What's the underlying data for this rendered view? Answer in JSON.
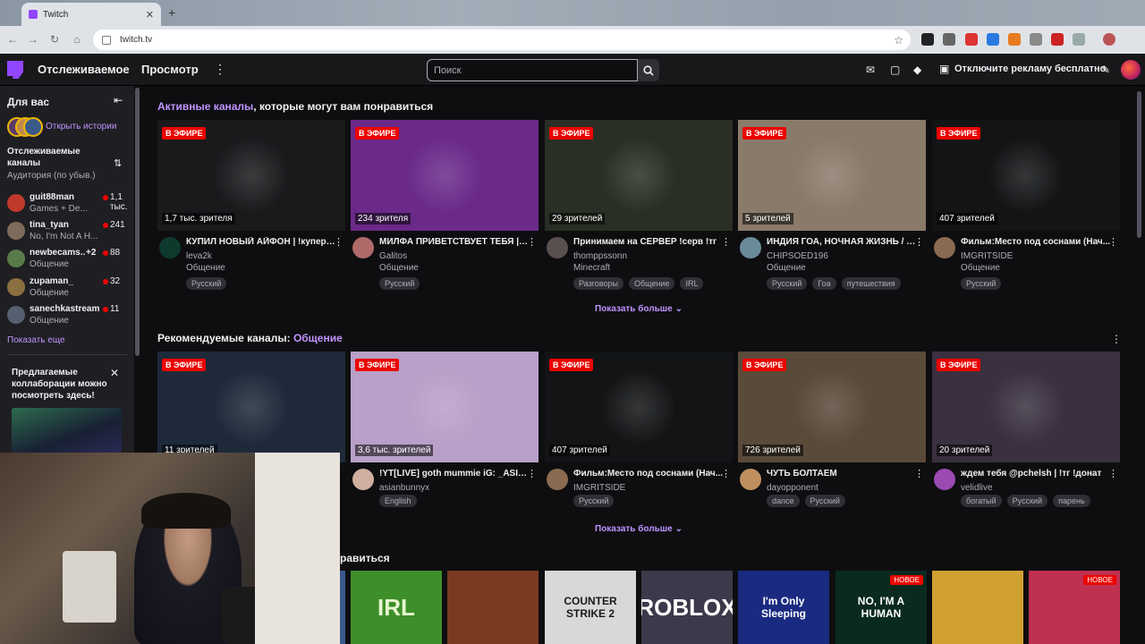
{
  "browser": {
    "tab_title": "Twitch",
    "url": "twitch.tv"
  },
  "topnav": {
    "following": "Отслеживаемое",
    "browse": "Просмотр",
    "search_placeholder": "Поиск",
    "ad_free": "Отключите рекламу бесплатно"
  },
  "sidebar": {
    "title": "Для вас",
    "open_stories": "Открыть истории",
    "followed": "Отслеживаемые каналы",
    "sort_label": "Аудитория (по убыв.)",
    "channels": [
      {
        "name": "guit88man",
        "category": "Games + De...",
        "viewers": "1,1 тыс.",
        "color": "#c0392b"
      },
      {
        "name": "tina_tyan",
        "category": "No, I'm Not A H...",
        "viewers": "241",
        "color": "#7e6b5a"
      },
      {
        "name": "newbecams...",
        "category": "Общение",
        "viewers": "88",
        "color": "#5b7a4a",
        "extra": "+2"
      },
      {
        "name": "zupaman_",
        "category": "Общение",
        "viewers": "32",
        "color": "#8a7040"
      },
      {
        "name": "sanechkastream",
        "category": "Общение",
        "viewers": "11",
        "color": "#556070"
      }
    ],
    "show_more": "Показать еще",
    "collab_title": "Предлагаемые коллаборации можно посмотреть здесь!"
  },
  "sections": {
    "live_highlight": "Активные каналы",
    "live_rest": ", которые могут вам понравиться",
    "rec_label": "Рекомендуемые каналы: ",
    "rec_highlight": "Общение",
    "cat_partial": "равиться",
    "show_more": "Показать больше",
    "live_badge": "В ЭФИРЕ"
  },
  "row1": [
    {
      "viewers": "1,7 тыс. зрителя",
      "title": "КУПИЛ НОВЫЙ АЙФОН | !купер !...",
      "channel": "leva2k",
      "category": "Общение",
      "tags": [
        "Русский"
      ],
      "thumb": "#1a1a1d",
      "avatar": "#0e3a2e"
    },
    {
      "viewers": "234 зрителя",
      "title": "МИЛФА ПРИВЕТСТВУЕТ ТЕБЯ | !...",
      "channel": "Galitos",
      "category": "Общение",
      "tags": [
        "Русский"
      ],
      "thumb": "#6b2a8a",
      "avatar": "#b06a6a"
    },
    {
      "viewers": "29 зрителей",
      "title": "Принимаем на СЕРВЕР !серв !тг",
      "channel": "thomppssonn",
      "category": "Minecraft",
      "tags": [
        "Разговоры",
        "Общение",
        "IRL"
      ],
      "thumb": "#2a2f25",
      "avatar": "#5a5050"
    },
    {
      "viewers": "5 зрителей",
      "title": "ИНДИЯ ГОА, НОЧНАЯ ЖИЗНЬ / 1...",
      "channel": "CHIPSOED196",
      "category": "Общение",
      "tags": [
        "Русский",
        "Гоа",
        "путешествия"
      ],
      "thumb": "#8a7a6a",
      "avatar": "#6a8a9a"
    },
    {
      "viewers": "407 зрителей",
      "title": "Фильм:Место под соснами (Нач...",
      "channel": "IMGRITSIDE",
      "category": "Общение",
      "tags": [
        "Русский"
      ],
      "thumb": "#121416",
      "avatar": "#8a6a50"
    }
  ],
  "row2": [
    {
      "viewers": "11 зрителей",
      "title": "",
      "channel": "",
      "category": "",
      "tags": [],
      "thumb": "#1e2a3a",
      "avatar": "#333"
    },
    {
      "viewers": "3,6 тыс. зрителей",
      "title": "!YT[LIVE] goth mummie iG: _ASIA...",
      "channel": "asianbunnyx",
      "category": "",
      "tags": [
        "English"
      ],
      "thumb": "#b8a0c8",
      "avatar": "#d0b0a0"
    },
    {
      "viewers": "407 зрителей",
      "title": "Фильм:Место под соснами (Нач...",
      "channel": "IMGRITSIDE",
      "category": "",
      "tags": [
        "Русский"
      ],
      "thumb": "#121416",
      "avatar": "#8a6a50"
    },
    {
      "viewers": "726 зрителей",
      "title": "ЧУТЬ БОЛТАЕМ",
      "channel": "dayopponent",
      "category": "",
      "tags": [
        "dance",
        "Русский"
      ],
      "thumb": "#5a4a3a",
      "avatar": "#c09060"
    },
    {
      "viewers": "20 зрителей",
      "title": "ждем тебя @pchelsh | !тг !донат",
      "channel": "velidlive",
      "category": "",
      "tags": [
        "богатый",
        "Русский",
        "парень"
      ],
      "thumb": "#3a3040",
      "avatar": "#9a4ab0"
    }
  ],
  "categories": [
    {
      "label": "IRL",
      "bg": "#3e8f2a",
      "fg": "#e8f5d0",
      "new": false
    },
    {
      "label": "",
      "bg": "#7a3a20",
      "fg": "#fff",
      "new": false
    },
    {
      "label": "COUNTER STRIKE 2",
      "bg": "#d8d8d8",
      "fg": "#1a1a1a",
      "new": false
    },
    {
      "label": "ROBLOX",
      "bg": "#3a3a4a",
      "fg": "#ffffff",
      "new": false
    },
    {
      "label": "I'm Only Sleeping",
      "bg": "#1a2a80",
      "fg": "#ffffff",
      "new": false
    },
    {
      "label": "NO, I'M A HUMAN",
      "bg": "#0a2a20",
      "fg": "#ffffff",
      "new": true
    },
    {
      "label": "",
      "bg": "#d0a030",
      "fg": "#fff",
      "new": false
    },
    {
      "label": "",
      "bg": "#c03050",
      "fg": "#fff",
      "new": true
    }
  ],
  "new_badge": "НОВОЕ"
}
